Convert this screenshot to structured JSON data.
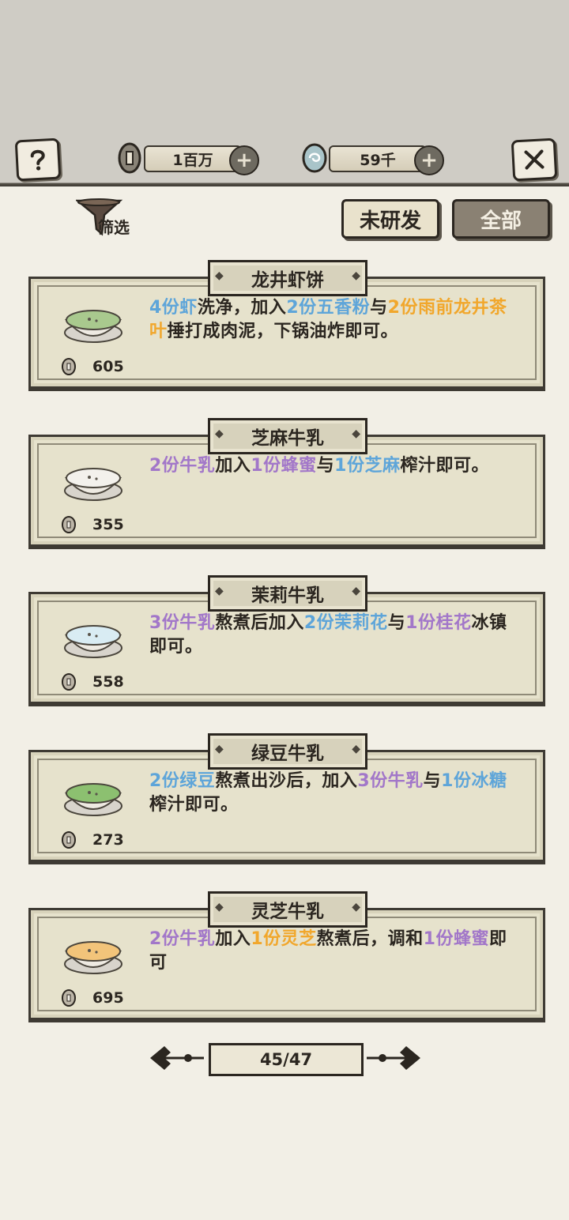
{
  "hud": {
    "help_icon": "question-mark-icon",
    "coins": {
      "value": "1百万",
      "icon": "copper-coin-icon"
    },
    "jade": {
      "value": "59千",
      "icon": "jade-orb-icon"
    },
    "close_icon": "close-x-icon"
  },
  "filter": {
    "label": "筛选",
    "icon": "funnel-icon"
  },
  "tabs": {
    "undeveloped": "未研发",
    "all": "全部"
  },
  "recipes": [
    {
      "title": "龙井虾饼",
      "price": "605",
      "dish_color": "#a9c98e",
      "desc": [
        {
          "t": "4份虾",
          "c": "blue"
        },
        {
          "t": "洗净，加入",
          "c": ""
        },
        {
          "t": "2份五香粉",
          "c": "blue"
        },
        {
          "t": "与",
          "c": ""
        },
        {
          "t": "2份雨前龙井茶叶",
          "c": "orange"
        },
        {
          "t": "捶打成肉泥，下锅油炸即可。",
          "c": ""
        }
      ]
    },
    {
      "title": "芝麻牛乳",
      "price": "355",
      "dish_color": "#f3f1ec",
      "desc": [
        {
          "t": "2份牛乳",
          "c": "purple"
        },
        {
          "t": "加入",
          "c": ""
        },
        {
          "t": "1份蜂蜜",
          "c": "purple"
        },
        {
          "t": "与",
          "c": ""
        },
        {
          "t": "1份芝麻",
          "c": "blue"
        },
        {
          "t": "榨汁即可。",
          "c": ""
        }
      ]
    },
    {
      "title": "茉莉牛乳",
      "price": "558",
      "dish_color": "#d9ecf3",
      "desc": [
        {
          "t": "3份牛乳",
          "c": "purple"
        },
        {
          "t": "熬煮后加入",
          "c": ""
        },
        {
          "t": "2份茉莉花",
          "c": "blue"
        },
        {
          "t": "与",
          "c": ""
        },
        {
          "t": "1份桂花",
          "c": "purple"
        },
        {
          "t": "冰镇即可。",
          "c": ""
        }
      ]
    },
    {
      "title": "绿豆牛乳",
      "price": "273",
      "dish_color": "#8cc070",
      "desc": [
        {
          "t": "2份绿豆",
          "c": "blue"
        },
        {
          "t": "熬煮出沙后，加入",
          "c": ""
        },
        {
          "t": "3份牛乳",
          "c": "purple"
        },
        {
          "t": "与",
          "c": ""
        },
        {
          "t": "1份冰糖",
          "c": "blue"
        },
        {
          "t": "榨汁即可。",
          "c": ""
        }
      ]
    },
    {
      "title": "灵芝牛乳",
      "price": "695",
      "dish_color": "#f2c47a",
      "desc": [
        {
          "t": "2份牛乳",
          "c": "purple"
        },
        {
          "t": "加入",
          "c": ""
        },
        {
          "t": "1份灵芝",
          "c": "orange"
        },
        {
          "t": "熬煮后，调和",
          "c": ""
        },
        {
          "t": "1份蜂蜜",
          "c": "purple"
        },
        {
          "t": "即可",
          "c": ""
        }
      ]
    }
  ],
  "pager": {
    "label": "45/47",
    "prev_icon": "ornate-arrow-left-icon",
    "next_icon": "ornate-arrow-right-icon"
  }
}
